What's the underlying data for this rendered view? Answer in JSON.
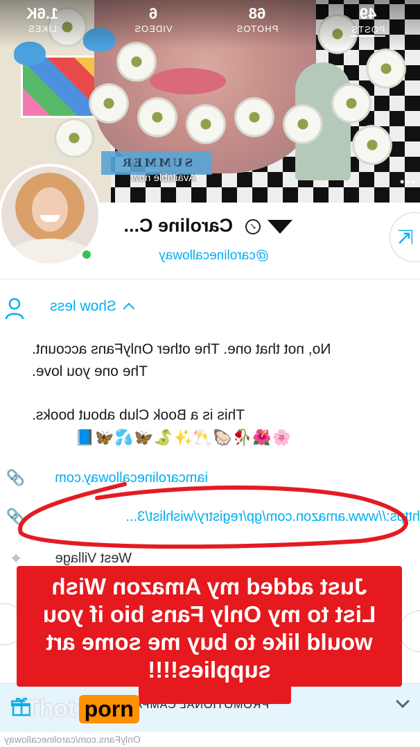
{
  "banner": {
    "label": "SUMMER",
    "status": "Available now",
    "more": "•••"
  },
  "stats": [
    {
      "value": "49",
      "label": "POSTS",
      "active": true
    },
    {
      "value": "68",
      "label": "PHOTOS"
    },
    {
      "value": "6",
      "label": "VIDEOS"
    },
    {
      "value": "1.6K",
      "label": "LIKES"
    }
  ],
  "profile": {
    "name": "Caroline C...",
    "handle": "@carolinecalloway",
    "online": true
  },
  "about": {
    "toggle": "Show less",
    "bio_line1": "No, not that one. The other OnlyFans account.",
    "bio_line2": "The one you love.",
    "bio_line3": "This is a Book Club about books.",
    "emojis": "🌸🌺🥀🦪🥂✨🐍🦋💦🦋📘",
    "website": "iamcarolinecalloway.com",
    "wishlist_url": "https://www.amazon.com/gp/registry/wishlist/3...",
    "location": "West Village"
  },
  "promo": {
    "label": "PROMOTIONAL CAMPAIGNS"
  },
  "footer": {
    "url": "OnlyFans.com/carolinecalloway"
  },
  "overlay": {
    "caption": "Just added my Amazon Wish List to my Only Fans bio if you would like to buy me some art supplies!!!!",
    "watermark_left": "Thot",
    "watermark_right": "porn"
  },
  "colors": {
    "accent": "#00aff0",
    "caption_bg": "#e5191e",
    "online": "#37c24f"
  }
}
